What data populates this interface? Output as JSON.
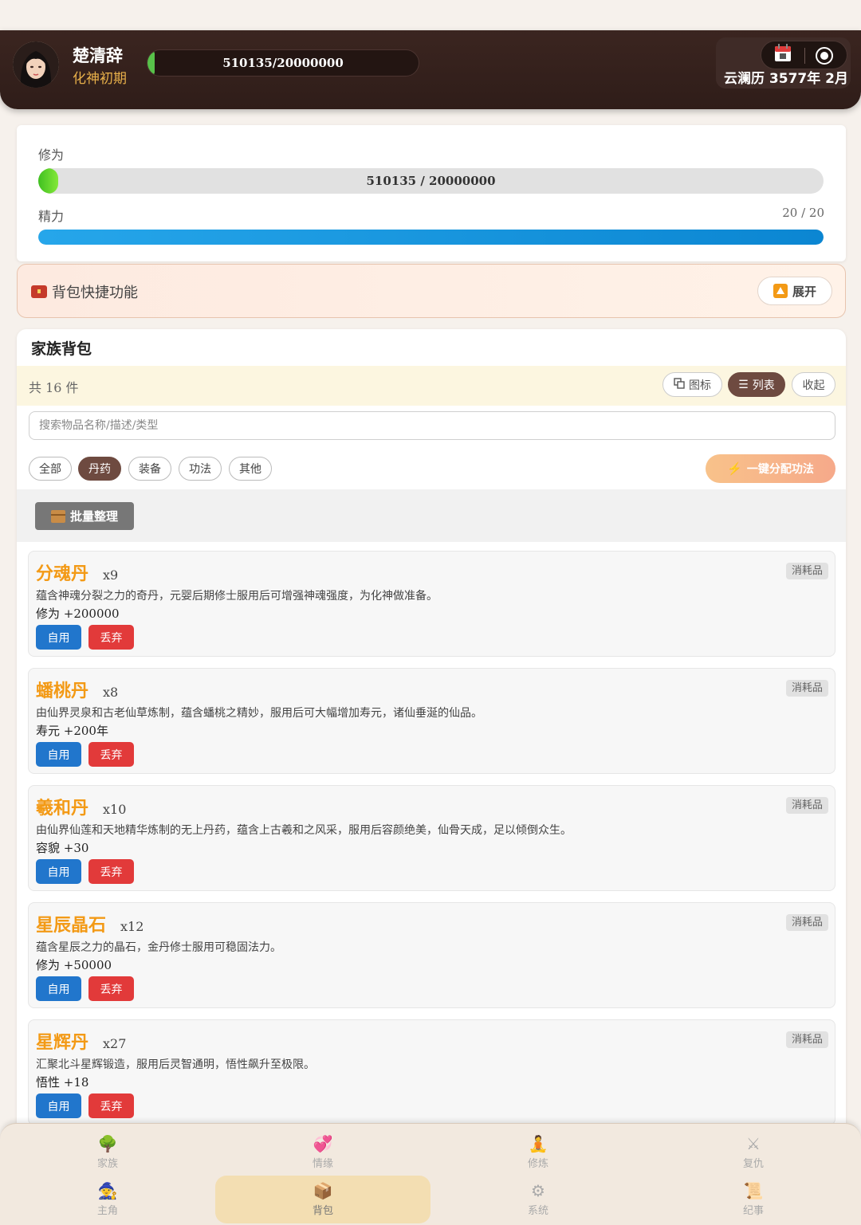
{
  "header": {
    "char_name": "楚清辞",
    "realm": "化神初期",
    "exp_text": "510135/20000000",
    "exp_fraction": 0.0255,
    "date_text": "云澜历 3577年 2月"
  },
  "stats": {
    "cultivation_label": "修为",
    "cultivation_text": "510135 / 20000000",
    "cultivation_fraction": 0.0255,
    "energy_label": "精力",
    "energy_text": "20 / 20",
    "energy_fraction": 1.0
  },
  "quick": {
    "title": "背包快捷功能",
    "expand_label": "展开"
  },
  "bag": {
    "title": "家族背包",
    "count_text": "共 16 件",
    "view_icon_label": "图标",
    "view_list_label": "列表",
    "collapse_label": "收起",
    "search_placeholder": "搜索物品名称/描述/类型",
    "filters": [
      "全部",
      "丹药",
      "装备",
      "功法",
      "其他"
    ],
    "active_filter": "丹药",
    "assign_label": "一键分配功法",
    "batch_label": "批量整理",
    "use_label": "自用",
    "drop_label": "丢弃",
    "items": [
      {
        "name": "分魂丹",
        "qty": "x9",
        "type": "消耗品",
        "desc": "蕴含神魂分裂之力的奇丹，元婴后期修士服用后可增强神魂强度，为化神做准备。",
        "effect": "修为 +200000"
      },
      {
        "name": "蟠桃丹",
        "qty": "x8",
        "type": "消耗品",
        "desc": "由仙界灵泉和古老仙草炼制，蕴含蟠桃之精妙，服用后可大幅增加寿元，诸仙垂涎的仙品。",
        "effect": "寿元 +200年"
      },
      {
        "name": "羲和丹",
        "qty": "x10",
        "type": "消耗品",
        "desc": "由仙界仙莲和天地精华炼制的无上丹药，蕴含上古羲和之风采，服用后容颜绝美，仙骨天成，足以倾倒众生。",
        "effect": "容貌 +30"
      },
      {
        "name": "星辰晶石",
        "qty": "x12",
        "type": "消耗品",
        "desc": "蕴含星辰之力的晶石，金丹修士服用可稳固法力。",
        "effect": "修为 +50000"
      },
      {
        "name": "星辉丹",
        "qty": "x27",
        "type": "消耗品",
        "desc": "汇聚北斗星辉锻造，服用后灵智通明，悟性飙升至极限。",
        "effect": "悟性 +18"
      }
    ]
  },
  "nav": {
    "row1": [
      {
        "label": "家族",
        "icon": "tree-icon"
      },
      {
        "label": "情缘",
        "icon": "hearts-icon"
      },
      {
        "label": "修炼",
        "icon": "meditate-icon"
      },
      {
        "label": "复仇",
        "icon": "swords-icon"
      }
    ],
    "row2": [
      {
        "label": "主角",
        "icon": "mage-icon"
      },
      {
        "label": "背包",
        "icon": "package-icon"
      },
      {
        "label": "系统",
        "icon": "gear-icon"
      },
      {
        "label": "纪事",
        "icon": "scroll-icon"
      }
    ],
    "active": "背包"
  }
}
